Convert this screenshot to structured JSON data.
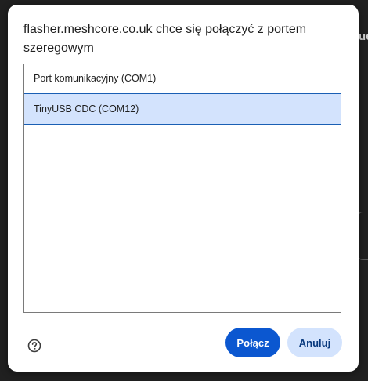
{
  "dialog": {
    "title": "flasher.meshcore.co.uk chce się połączyć z portem szeregowym",
    "ports": [
      {
        "label": "Port komunikacyjny (COM1)",
        "selected": false
      },
      {
        "label": "TinyUSB CDC (COM12)",
        "selected": true
      }
    ],
    "help_icon": "help-circle-icon",
    "connect_label": "Połącz",
    "cancel_label": "Anuluj"
  },
  "background": {
    "fragment_text": "ue"
  },
  "colors": {
    "primary": "#0b57d0",
    "selection": "#d3e3fd",
    "selection_border": "#1a5fb4",
    "backdrop": "#202020"
  }
}
